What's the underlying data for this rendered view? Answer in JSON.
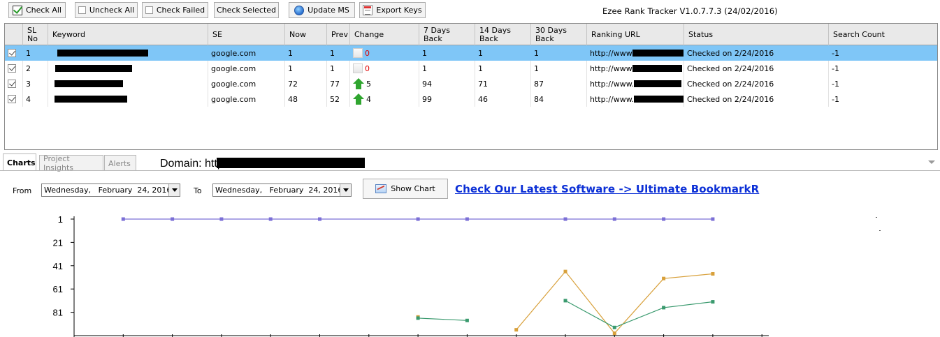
{
  "app": {
    "title": "Ezee Rank Tracker V1.0.7.7.3 (24/02/2016)"
  },
  "toolbar": {
    "check_all": "Check All",
    "uncheck_all": "Uncheck All",
    "check_failed": "Check Failed",
    "check_selected": "Check Selected",
    "update_ms": "Update MS",
    "export_keys": "Export Keys"
  },
  "grid": {
    "headers": {
      "sl_no": "SL No",
      "keyword": "Keyword",
      "se": "SE",
      "now": "Now",
      "prev": "Prev",
      "change": "Change",
      "days7": "7 Days Back",
      "days14": "14 Days Back",
      "days30": "30 Days Back",
      "ranking_url": "Ranking URL",
      "status": "Status",
      "search_count": "Search Count"
    },
    "rows": [
      {
        "sl": "1",
        "se": "google.com",
        "now": "1",
        "prev": "1",
        "change": "0",
        "change_dir": "none",
        "d7": "1",
        "d14": "1",
        "d30": "1",
        "url": "http://www",
        "status": "Checked on 2/24/2016",
        "count": "-1",
        "selected": true
      },
      {
        "sl": "2",
        "se": "google.com",
        "now": "1",
        "prev": "1",
        "change": "0",
        "change_dir": "none",
        "d7": "1",
        "d14": "1",
        "d30": "1",
        "url": "http://www",
        "status": "Checked on 2/24/2016",
        "count": "-1",
        "selected": false
      },
      {
        "sl": "3",
        "se": "google.com",
        "now": "72",
        "prev": "77",
        "change": "5",
        "change_dir": "up",
        "d7": "94",
        "d14": "71",
        "d30": "87",
        "url": "http://www.",
        "status": "Checked on 2/24/2016",
        "count": "-1",
        "selected": false
      },
      {
        "sl": "4",
        "se": "google.com",
        "now": "48",
        "prev": "52",
        "change": "4",
        "change_dir": "up",
        "d7": "99",
        "d14": "46",
        "d30": "84",
        "url": "http://www.",
        "status": "Checked on 2/24/2016",
        "count": "-1",
        "selected": false
      }
    ]
  },
  "tabs": {
    "charts": "Charts",
    "insights": "Project Insights",
    "alerts": "Alerts"
  },
  "domain": {
    "label": "Domain: http:"
  },
  "filter": {
    "from_label": "From",
    "to_label": "To",
    "from_date": "Wednesday,   February  24, 2016",
    "to_date": "Wednesday,   February  24, 2016",
    "show_chart": "Show Chart",
    "promo": "Check Our Latest Software -> Ultimate BookmarkR"
  },
  "colors": {
    "selection": "#7fc6f7",
    "series_purple": "#7b6fd6",
    "series_orange": "#d8a03a",
    "series_green": "#3a9a6e",
    "link": "#0b2fd6"
  },
  "chart_data": {
    "type": "line",
    "y_ticks": [
      "1",
      "21",
      "41",
      "61",
      "81"
    ],
    "ylim": [
      1,
      101
    ],
    "y_inverted": true,
    "x_count": 14,
    "series": [
      {
        "color": "#7b6fd6",
        "points": [
          [
            1,
            1
          ],
          [
            2,
            1
          ],
          [
            3,
            1
          ],
          [
            4,
            1
          ],
          [
            5,
            1
          ],
          [
            7,
            1
          ],
          [
            8,
            1
          ],
          [
            10,
            1
          ],
          [
            11,
            1
          ],
          [
            12,
            1
          ],
          [
            13,
            1
          ]
        ]
      },
      {
        "color": "#d8a03a",
        "points": [
          [
            7,
            85
          ]
        ]
      },
      {
        "color": "#d8a03a",
        "points": [
          [
            9,
            96
          ],
          [
            10,
            46
          ],
          [
            11,
            99
          ],
          [
            12,
            52
          ],
          [
            13,
            48
          ]
        ]
      },
      {
        "color": "#3a9a6e",
        "points": [
          [
            7,
            86
          ],
          [
            8,
            88
          ]
        ]
      },
      {
        "color": "#3a9a6e",
        "points": [
          [
            10,
            71
          ],
          [
            11,
            94
          ],
          [
            12,
            77
          ],
          [
            13,
            72
          ]
        ]
      }
    ]
  }
}
